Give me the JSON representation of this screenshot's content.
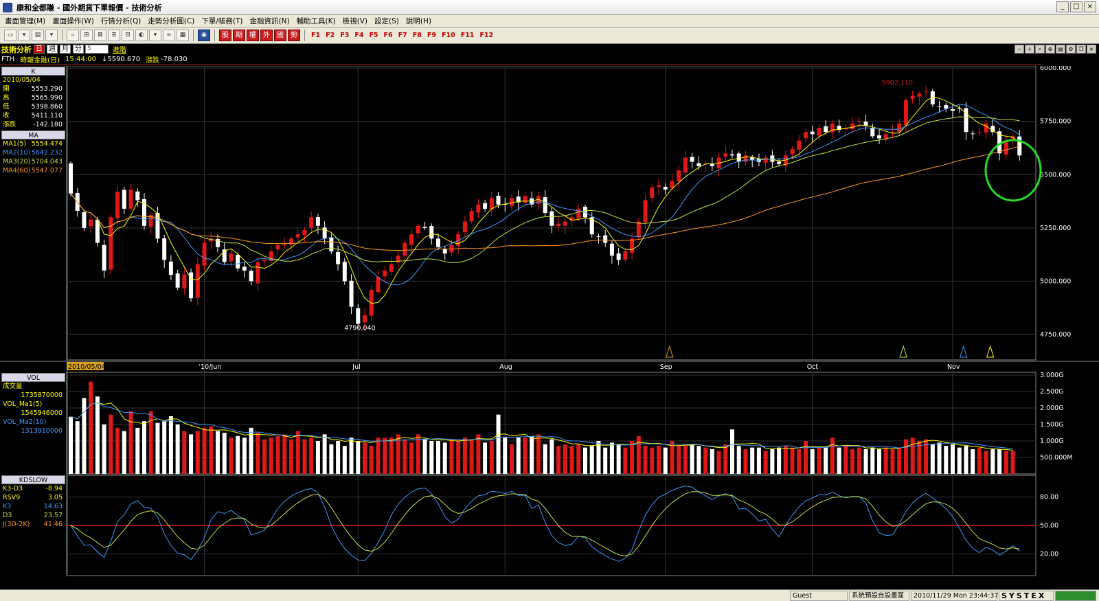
{
  "window": {
    "title": "康和全都賺 - 國外期貨下單報價 - 技術分析",
    "buttons": [
      "_",
      "□",
      "×"
    ]
  },
  "menu": [
    "畫面管理(M)",
    "畫面操作(W)",
    "行情分析(Q)",
    "走勢分析圖(C)",
    "下單/帳務(T)",
    "金融資訊(N)",
    "輔助工具(K)",
    "檢視(V)",
    "設定(S)",
    "說明(H)"
  ],
  "toolbar": {
    "quote_buttons": [
      "股",
      "期",
      "權",
      "外",
      "國",
      "勢"
    ],
    "fkeys": [
      "F1",
      "F2",
      "F3",
      "F4",
      "F5",
      "F6",
      "F7",
      "F8",
      "F9",
      "F10",
      "F11",
      "F12"
    ]
  },
  "chart_header": {
    "panel_name": "技術分析",
    "periods": [
      "日",
      "週",
      "月",
      "分"
    ],
    "selected_period": "日",
    "combo_value": "5",
    "advanced_label": "進階",
    "symbol": "FTH",
    "symbol_name": "時報金融(日)",
    "time": "15:44:00",
    "price_arrow": "↓",
    "price": "5590.670",
    "change_label": "漲跌",
    "change": "-78.030"
  },
  "k_panel": {
    "title": "K",
    "date": "2010/05/04",
    "rows": [
      {
        "label": "開",
        "value": "5553.290"
      },
      {
        "label": "高",
        "value": "5565.990"
      },
      {
        "label": "低",
        "value": "5398.860"
      },
      {
        "label": "收",
        "value": "5411.110"
      },
      {
        "label": "漲跌",
        "value": "-142.180"
      }
    ]
  },
  "ma_panel": {
    "title": "MA",
    "rows": [
      {
        "label": "MA1(5)",
        "value": "5554.474",
        "color": "#ffff00"
      },
      {
        "label": "MA2(10)",
        "value": "5642.232",
        "color": "#3d9bff"
      },
      {
        "label": "MA3(20)",
        "value": "5704.043",
        "color": "#c8e040"
      },
      {
        "label": "MA4(60)",
        "value": "5547.077",
        "color": "#ff9a20"
      }
    ]
  },
  "vol_panel": {
    "title": "VOL",
    "rows": [
      {
        "label": "成交量",
        "value": "",
        "color": "#ffff00"
      },
      {
        "label": "",
        "value": "1735870000",
        "color": "#ffff00"
      },
      {
        "label": "VOL_Ma1(5)",
        "value": "",
        "color": "#ffff00"
      },
      {
        "label": "",
        "value": "1545946000",
        "color": "#ffff00"
      },
      {
        "label": "VOL_Ma2(10)",
        "value": "",
        "color": "#3d9bff"
      },
      {
        "label": "",
        "value": "1313910000",
        "color": "#3d9bff"
      }
    ]
  },
  "kd_panel": {
    "title": "KDSLOW",
    "rows": [
      {
        "label": "K3-D3",
        "value": "-8.94",
        "color": "#ffff00"
      },
      {
        "label": "RSV9",
        "value": "3.05",
        "color": "#ffff00"
      },
      {
        "label": "K3",
        "value": "14.63",
        "color": "#3d9bff"
      },
      {
        "label": "D3",
        "value": "23.57",
        "color": "#c8e040"
      },
      {
        "label": "J(3D-2K)",
        "value": "41.46",
        "color": "#ff9a20"
      }
    ]
  },
  "chart_data": [
    {
      "type": "candlestick",
      "title": "",
      "ylim": [
        4650,
        6010
      ],
      "y_ticks": [
        "6000.000",
        "5750.000",
        "5500.000",
        "5250.000",
        "5000.000",
        "4750.000"
      ],
      "x_tick_labels": [
        "2010/05/04",
        "'10/Jun",
        "Jul",
        "Aug",
        "Sep",
        "Oct",
        "Nov"
      ],
      "annotations": {
        "high": "5902.110",
        "low": "4790.040"
      },
      "grid": true,
      "series_colors": {
        "up": "#e01818",
        "down": "#ffffff",
        "ma5": "#ffff00",
        "ma10": "#3d9bff",
        "ma20": "#c8e040",
        "ma60": "#ff9a20"
      },
      "closes": [
        5411,
        5330,
        5250,
        5290,
        5180,
        5050,
        5300,
        5420,
        5340,
        5430,
        5380,
        5260,
        5310,
        5200,
        5100,
        5030,
        4970,
        5030,
        4920,
        5080,
        5180,
        5200,
        5160,
        5090,
        5130,
        5060,
        5050,
        5000,
        5090,
        5100,
        5140,
        5170,
        5180,
        5200,
        5220,
        5240,
        5300,
        5260,
        5200,
        5140,
        5080,
        5000,
        4880,
        4800,
        4840,
        4960,
        5020,
        5050,
        5080,
        5120,
        5180,
        5220,
        5260,
        5250,
        5200,
        5160,
        5130,
        5170,
        5220,
        5280,
        5330,
        5360,
        5340,
        5390,
        5360,
        5360,
        5390,
        5370,
        5400,
        5360,
        5400,
        5320,
        5260,
        5270,
        5280,
        5300,
        5340,
        5300,
        5220,
        5210,
        5180,
        5120,
        5100,
        5140,
        5200,
        5280,
        5380,
        5440,
        5450,
        5430,
        5470,
        5520,
        5580,
        5560,
        5540,
        5550,
        5540,
        5580,
        5600,
        5590,
        5560,
        5590,
        5570,
        5560,
        5580,
        5560,
        5550,
        5590,
        5620,
        5660,
        5700,
        5690,
        5720,
        5700,
        5740,
        5710,
        5720,
        5740,
        5750,
        5730,
        5680,
        5670,
        5690,
        5700,
        5740,
        5850,
        5870,
        5880,
        5890,
        5830,
        5820,
        5810,
        5800,
        5810,
        5700,
        5690,
        5700,
        5740,
        5700,
        5600,
        5660,
        5680,
        5590
      ],
      "vol_ylim": [
        0,
        3000
      ],
      "vol_y_ticks": [
        "3.000G",
        "2.500G",
        "2.000G",
        "1.500G",
        "1.000G",
        "500.000M"
      ],
      "volumes_millions": [
        1736,
        1600,
        2300,
        2800,
        2350,
        1500,
        1800,
        1400,
        1300,
        1900,
        1400,
        1600,
        1900,
        1550,
        1600,
        1750,
        1500,
        1300,
        1200,
        1300,
        1400,
        1450,
        1300,
        1250,
        1100,
        1150,
        1100,
        1400,
        1250,
        1050,
        1100,
        1150,
        1200,
        1050,
        1300,
        1050,
        1100,
        1000,
        1200,
        900,
        1000,
        850,
        1100,
        1000,
        950,
        850,
        1100,
        1100,
        1100,
        1200,
        1050,
        950,
        1200,
        1050,
        1000,
        1000,
        950,
        1050,
        1000,
        1100,
        1050,
        1200,
        950,
        1000,
        1800,
        1100,
        900,
        1100,
        1100,
        1150,
        1200,
        900,
        1050,
        850,
        900,
        850,
        900,
        800,
        850,
        1000,
        800,
        950,
        900,
        800,
        1000,
        1150,
        850,
        800,
        850,
        800,
        1000,
        850,
        850,
        900,
        850,
        800,
        750,
        700,
        900,
        1350,
        850,
        750,
        800,
        800,
        700,
        750,
        800,
        850,
        800,
        750,
        1000,
        750,
        800,
        800,
        1100,
        800,
        850,
        750,
        800,
        750,
        800,
        750,
        800,
        750,
        800,
        1050,
        1100,
        1000,
        1050,
        900,
        950,
        850,
        900,
        800,
        850,
        750,
        800,
        700,
        750,
        750,
        700,
        700
      ],
      "kd_ylim": [
        0,
        100
      ],
      "kd_y_ticks": [
        "80.00",
        "50.00",
        "20.00"
      ]
    }
  ],
  "status_bar": {
    "user": "Guest",
    "layout": "系統預設自設畫面",
    "datetime": "2010/11/29 Mon 23:44:37",
    "brand": "SYSTEX"
  }
}
